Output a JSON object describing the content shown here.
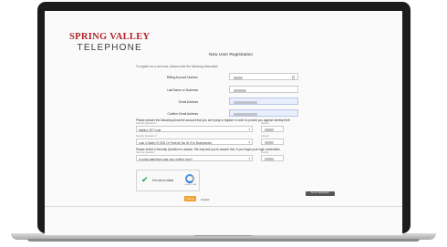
{
  "logo": {
    "line1": "SPRING VALLEY",
    "line2": "TELEPHONE"
  },
  "page": {
    "title": "New User Registration",
    "intro": "To register as a new user, please enter the following information"
  },
  "form": {
    "fields": [
      {
        "label": "Billing Account Number",
        "style": "plain"
      },
      {
        "label": "Last Name or Business",
        "style": "plain"
      },
      {
        "label": "Email Address",
        "style": "blue"
      },
      {
        "label": "Confirm Email Address",
        "style": "blue"
      }
    ],
    "security_prompt": "Please answer the following about the account that you are trying to register in order to protect you against Identity theft.",
    "question1": {
      "small_label": "Security Question 1",
      "selected": "Mailing ZIP Code",
      "answer_label": "Answer"
    },
    "question2": {
      "small_label": "Security Question 2",
      "selected": "Last 4 Digits Of SSN Or Federal Tax ID (For Businesses)",
      "answer_label": "Answer"
    },
    "reset_prompt": "Please select a Security Question to answer. We may ask you to answer this, if you forgot your login credentials.",
    "question3": {
      "small_label": "Security Question",
      "selected": "In what state/town was your mother born?",
      "answer_label": "Answer"
    }
  },
  "captcha": {
    "label": "I'm not a robot",
    "brand": "reCAPTCHA"
  },
  "actions": {
    "submit": "Submit",
    "cancel": "Cancel"
  },
  "badge": {
    "text": "Secure Registration"
  },
  "colors": {
    "brand_red": "#b3202a",
    "submit_orange": "#f0a030",
    "check_green": "#1ca04f"
  },
  "icons": {
    "dropdown": "chevron-down-icon",
    "captcha_check": "checkmark-icon",
    "lock": "lock-icon"
  }
}
